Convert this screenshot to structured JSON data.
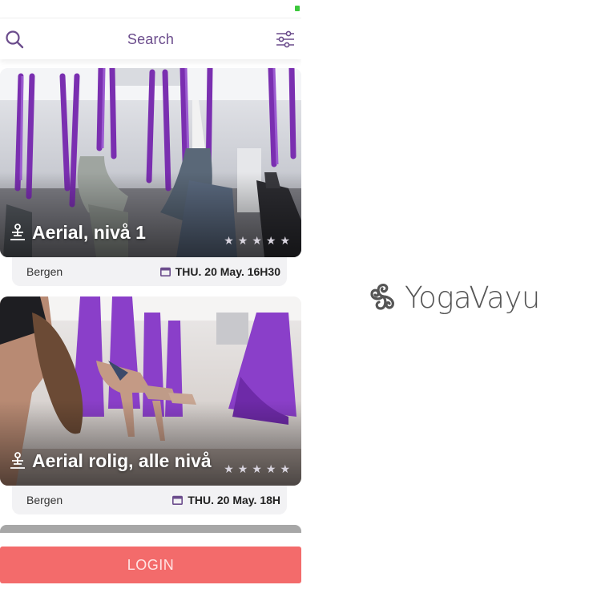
{
  "search": {
    "label": "Search"
  },
  "classes": [
    {
      "title": "Aerial, nivå 1",
      "location": "Bergen",
      "datetime": "THU. 20 May. 16H30",
      "rating": 0
    },
    {
      "title": "Aerial rolig, alle nivå",
      "location": "Bergen",
      "datetime": "THU. 20 May. 18H",
      "rating": 0
    }
  ],
  "login": {
    "label": "LOGIN"
  },
  "brand": {
    "name": "YogaVayu"
  },
  "colors": {
    "accent": "#6b4c8c",
    "login": "#f36b6b",
    "silk": "#7a2fb0"
  }
}
